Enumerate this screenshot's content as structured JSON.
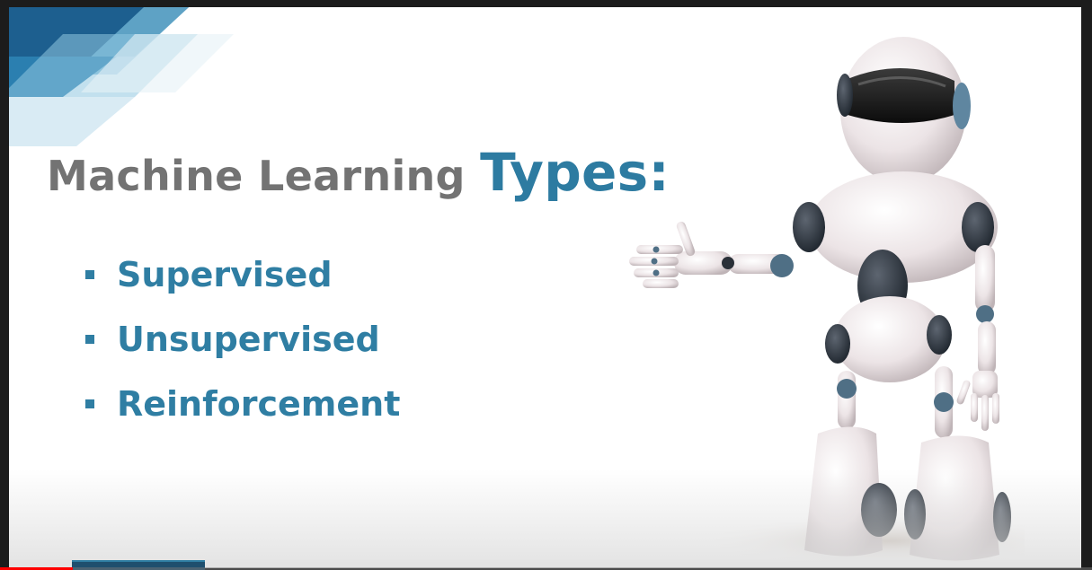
{
  "slide": {
    "title_main": "Machine Learning ",
    "title_accent": "Types:",
    "bullets": [
      "Supervised",
      "Unsupervised",
      "Reinforcement"
    ]
  },
  "player": {
    "progress_fraction": 0.067
  },
  "colors": {
    "accent": "#2f7ea3",
    "title_gray": "#737373",
    "progress": "#ff0000"
  },
  "icons": {
    "bullet": "square-bullet-icon",
    "illustration": "robot-illustration"
  }
}
